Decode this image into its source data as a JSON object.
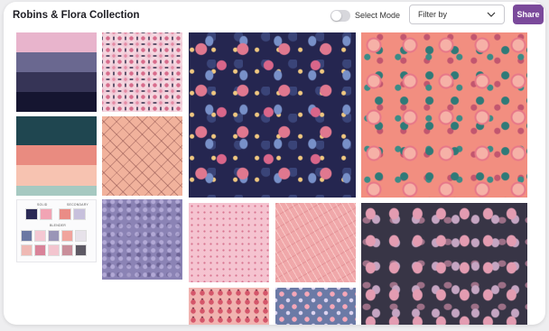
{
  "header": {
    "title": "Robins & Flora Collection",
    "select_mode_label": "Select Mode",
    "filter_label": "Filter by",
    "share_label": "Share"
  },
  "colors": {
    "accent": "#7b4a9b",
    "toggle_off": "#d7d7dc"
  },
  "palettes": [
    {
      "name": "lavender-navy-palette",
      "swatches": [
        "#e8b4cc",
        "#6a6890",
        "#363456",
        "#151530"
      ]
    },
    {
      "name": "teal-coral-palette",
      "swatches": [
        "#1f4650",
        "#e98b80",
        "#f7c3b1",
        "#a6c9c1"
      ]
    }
  ],
  "swatch_sheet": {
    "labels": [
      "SOLID",
      "SECONDARY",
      "BLENDER"
    ]
  },
  "patterns": [
    {
      "name": "pink-circle-flowers-pattern"
    },
    {
      "name": "peach-leaf-outline-pattern"
    },
    {
      "name": "lavender-texture-pattern"
    },
    {
      "name": "robins-navy-flora-pattern"
    },
    {
      "name": "coral-flora-pattern"
    },
    {
      "name": "pink-dots-pattern"
    },
    {
      "name": "pink-feather-pattern"
    },
    {
      "name": "dark-pink-leaves-pattern"
    },
    {
      "name": "pink-fruit-pattern"
    },
    {
      "name": "blue-flora-pattern"
    }
  ]
}
